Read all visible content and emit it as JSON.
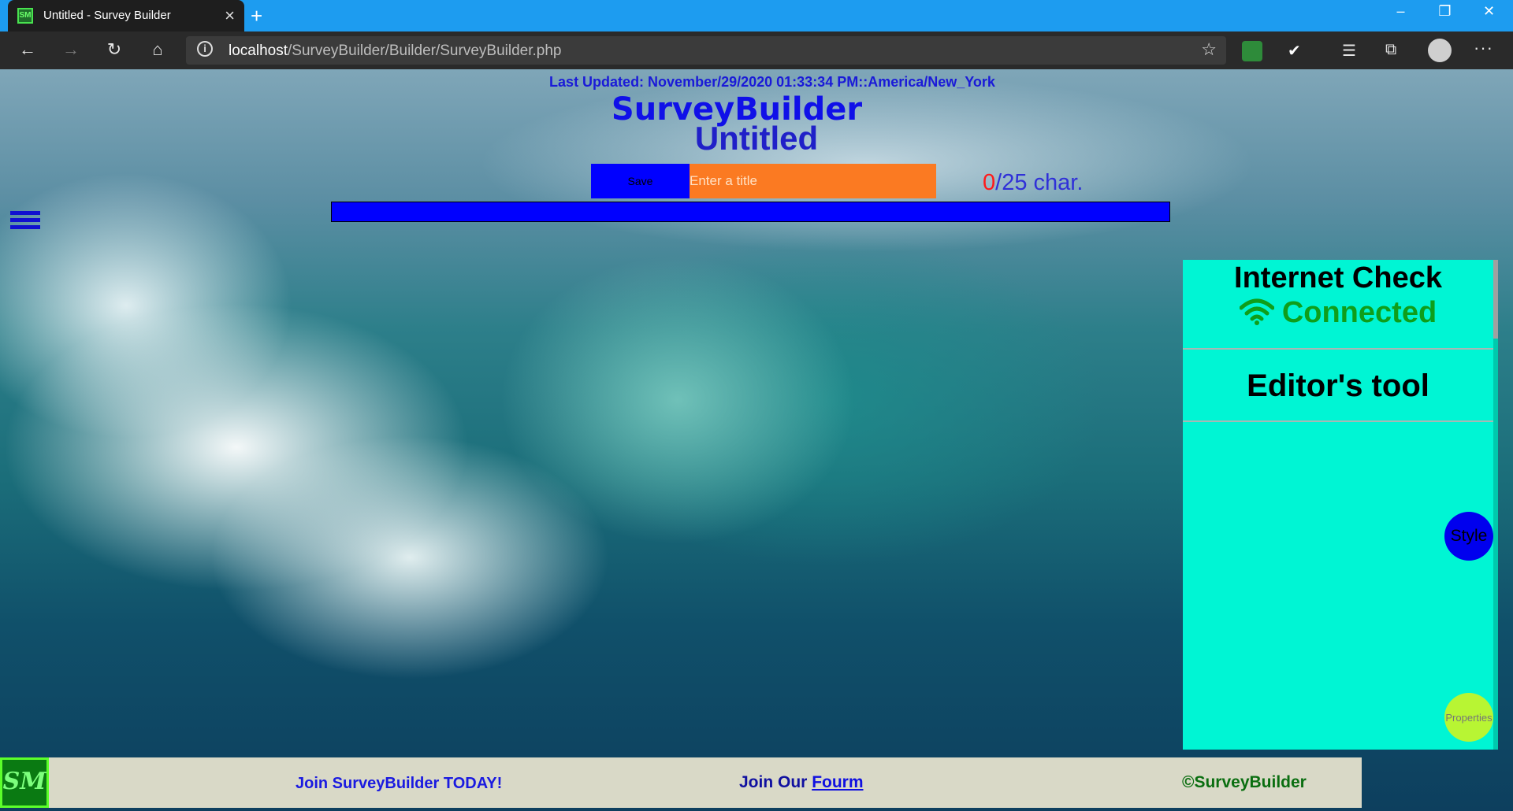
{
  "browser": {
    "tab_title": "Untitled - Survey Builder",
    "favicon_text": "SM",
    "url_host": "localhost",
    "url_path": "/SurveyBuilder/Builder/SurveyBuilder.php"
  },
  "page": {
    "last_updated": "Last Updated: November/29/2020 01:33:34 PM::America/New_York",
    "brand": "SurveyBuilder",
    "doc_title": "Untitled",
    "save_label": "Save",
    "title_placeholder": "Enter a title",
    "char_count": "0",
    "char_limit": "/25 char."
  },
  "sidepanel": {
    "internet_title": "Internet Check",
    "internet_status": "Connected",
    "editor_title": "Editor's tool",
    "style_label": "Style",
    "properties_label": "Properties"
  },
  "footer": {
    "logo_text": "SM",
    "join": "Join SurveyBuilder TODAY!",
    "forum_prefix": "Join Our ",
    "forum_link": "Fourm",
    "copyright": "©SurveyBuilder"
  },
  "colors": {
    "accent_blue": "#0000ff",
    "title_input_orange": "#fb7a22",
    "panel_cyan": "#00f5d4",
    "connected_green": "#0f9e1a",
    "properties_lime": "#b8f533"
  }
}
